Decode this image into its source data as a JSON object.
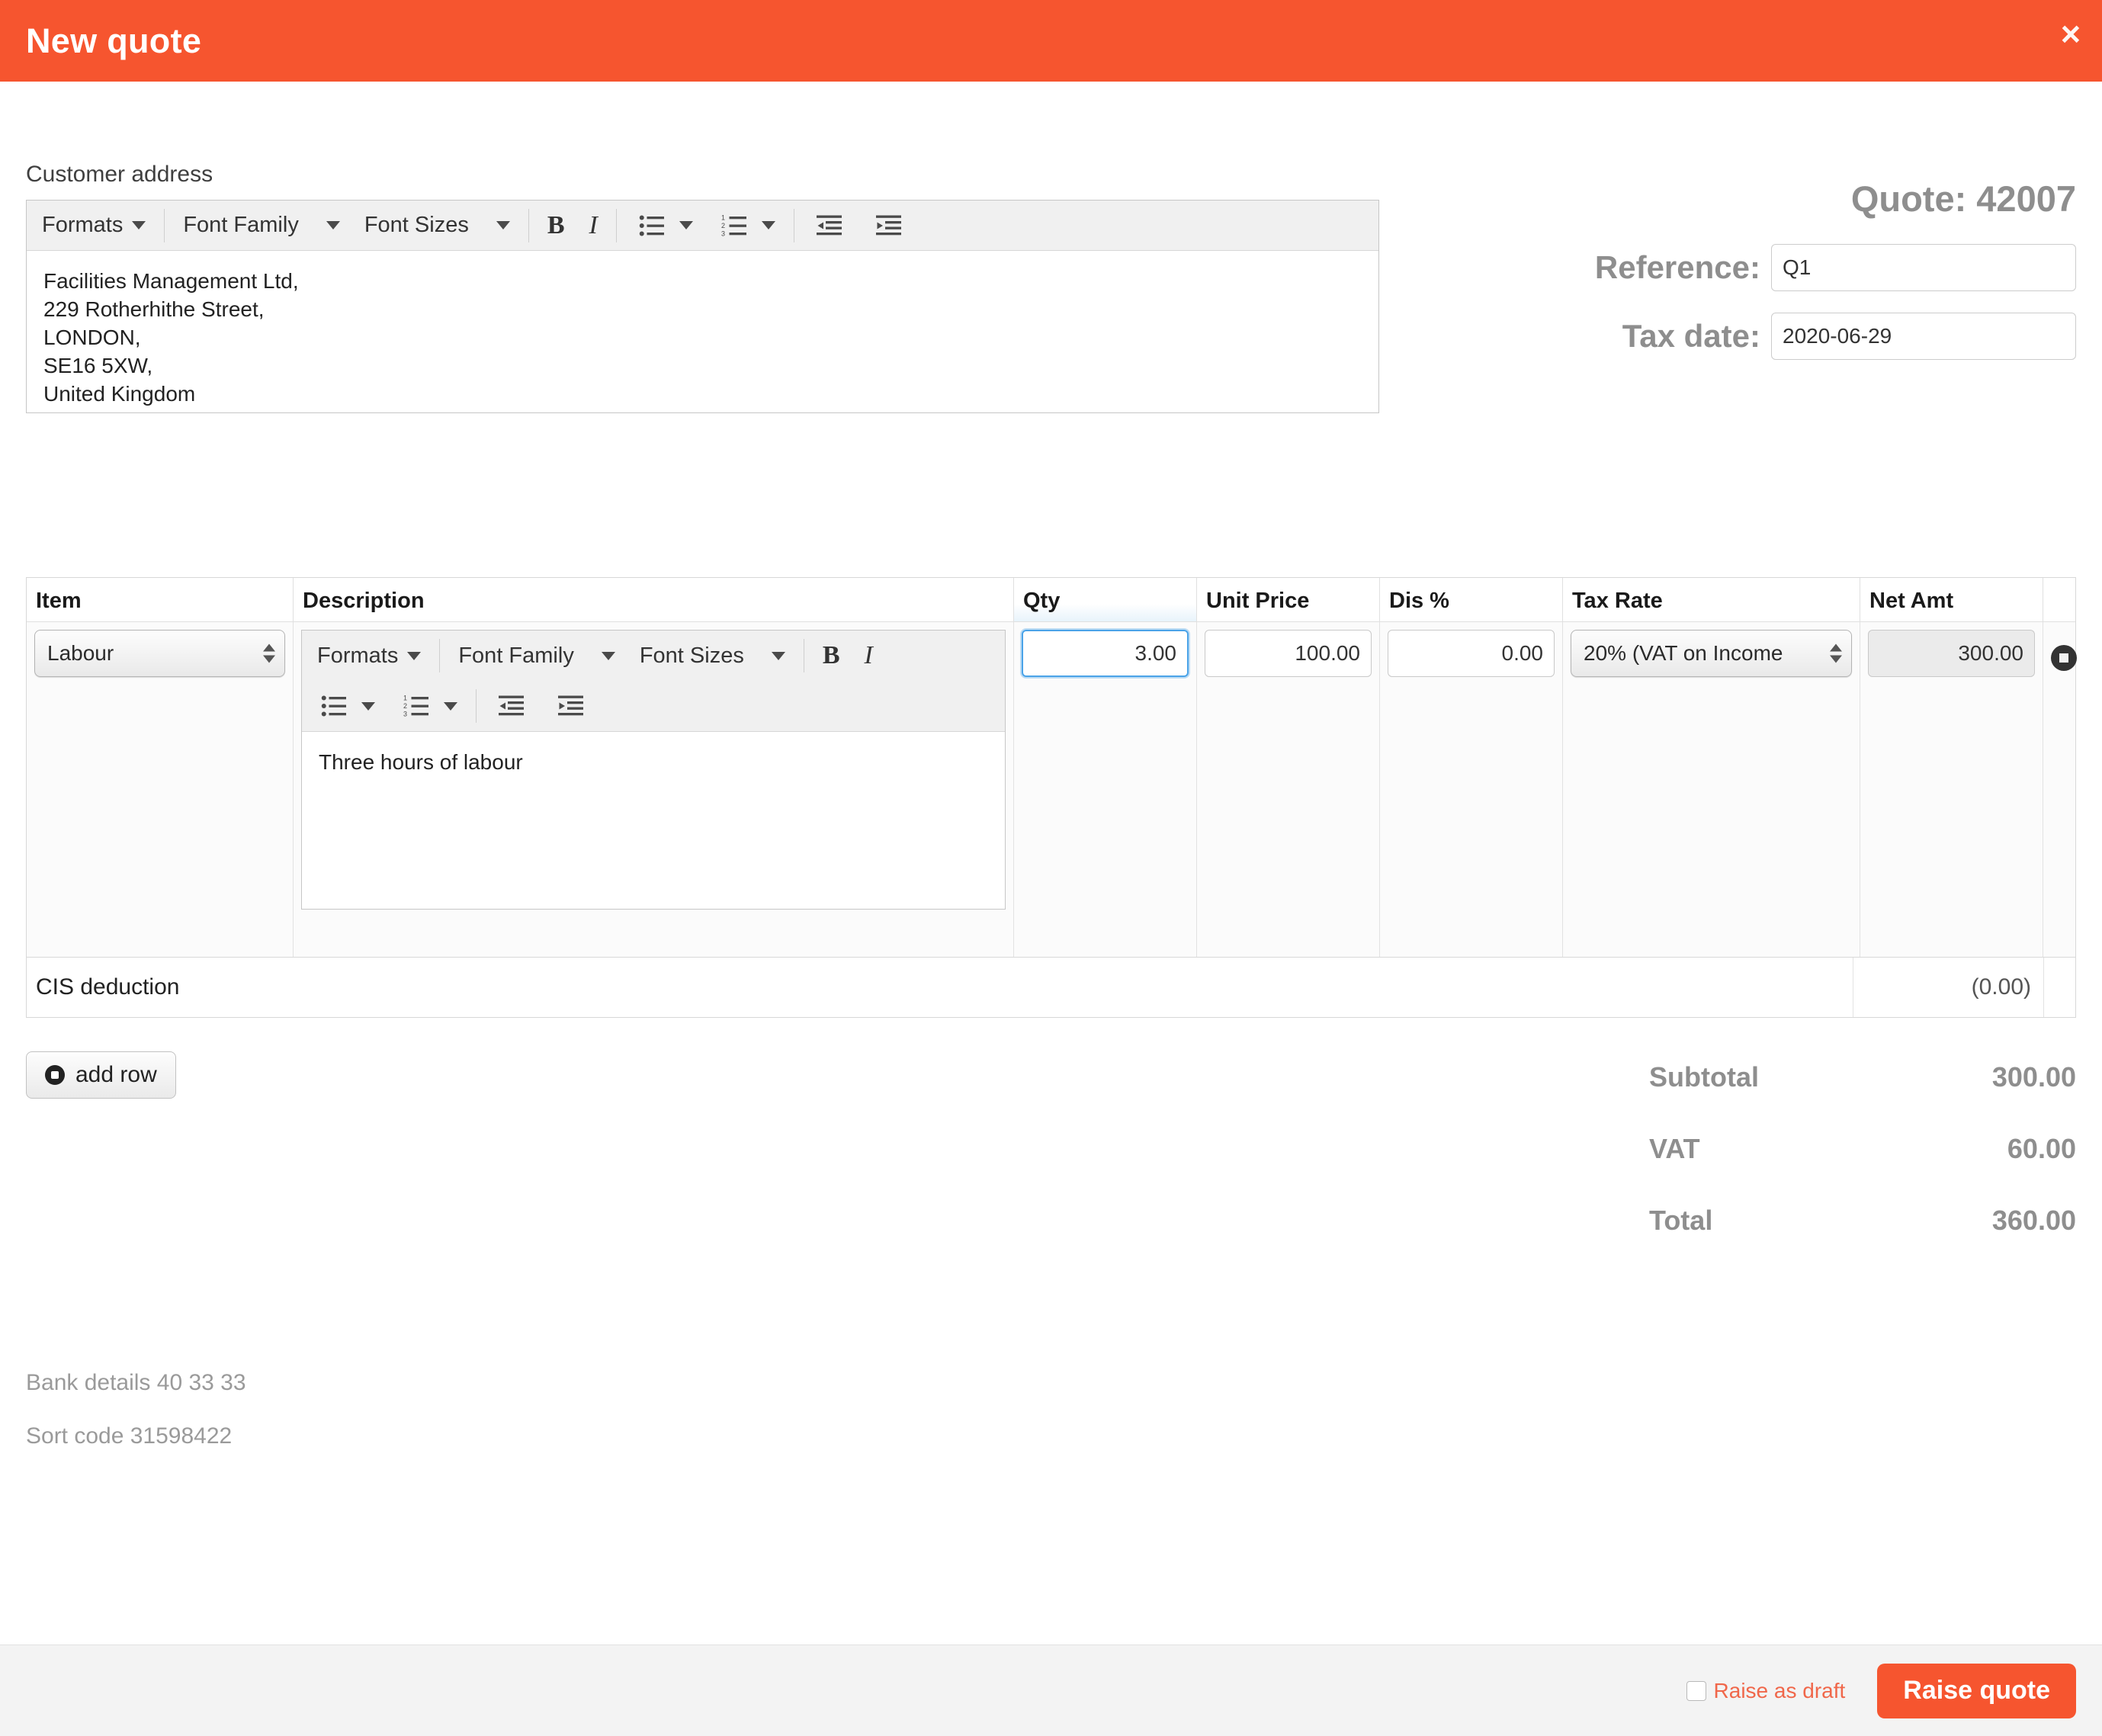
{
  "header": {
    "title": "New quote",
    "close_label": "×",
    "bg_color": "#f6552f"
  },
  "customer_address": {
    "label": "Customer address",
    "toolbar": {
      "formats": "Formats",
      "font_family": "Font Family",
      "font_sizes": "Font Sizes",
      "bold": "B",
      "italic": "I"
    },
    "lines": [
      "Facilities Management Ltd,",
      "229 Rotherhithe Street,",
      "LONDON,",
      "SE16 5XW,",
      "United Kingdom"
    ]
  },
  "meta": {
    "quote_number": "Quote: 42007",
    "reference_label": "Reference:",
    "reference_value": "Q1",
    "tax_date_label": "Tax date:",
    "tax_date_value": "2020-06-29"
  },
  "items_table": {
    "columns": [
      "Item",
      "Description",
      "Qty",
      "Unit Price",
      "Dis %",
      "Tax Rate",
      "Net Amt"
    ],
    "rows": [
      {
        "item": "Labour",
        "description_toolbar": {
          "formats": "Formats",
          "font_family": "Font Family",
          "font_sizes": "Font Sizes",
          "bold": "B",
          "italic": "I"
        },
        "description": "Three hours of labour",
        "qty": "3.00",
        "unit_price": "100.00",
        "discount_pct": "0.00",
        "tax_rate": "20% (VAT on Income",
        "net_amount": "300.00"
      }
    ],
    "cis_label": "CIS deduction",
    "cis_value": "(0.00)"
  },
  "actions": {
    "add_row": "add row"
  },
  "totals": [
    {
      "label": "Subtotal",
      "value": "300.00"
    },
    {
      "label": "VAT",
      "value": "60.00"
    },
    {
      "label": "Total",
      "value": "360.00"
    }
  ],
  "bank": {
    "line1": "Bank details 40 33 33",
    "line2": "Sort code 31598422"
  },
  "footer": {
    "draft_label": "Raise as draft",
    "submit_label": "Raise quote",
    "accent_color": "#f6552f"
  }
}
